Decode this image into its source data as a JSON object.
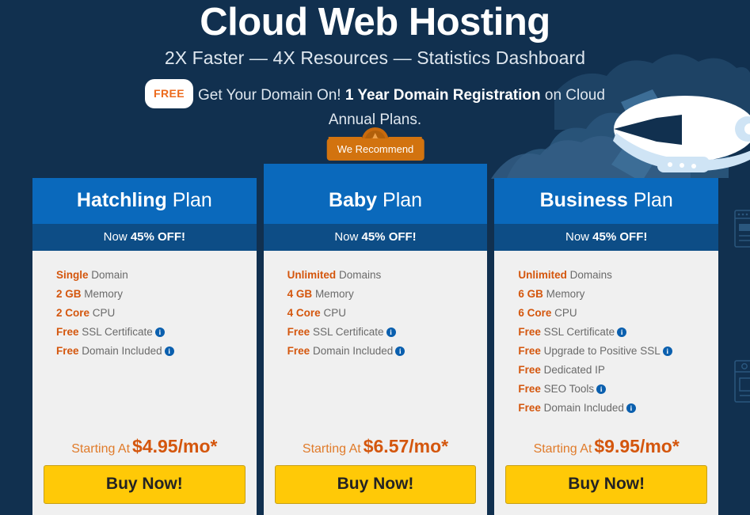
{
  "hero": {
    "title": "Cloud Web Hosting",
    "subtitle": "2X Faster — 4X Resources — Statistics Dashboard",
    "free_badge": "FREE",
    "promo_part1": "Get Your Domain On! ",
    "promo_bold": "1 Year Domain Registration",
    "promo_part2": " on Cloud Annual Plans."
  },
  "ribbon": {
    "label": "We Recommend"
  },
  "plans": [
    {
      "name_bold": "Hatchling",
      "name_rest": " Plan",
      "offer_prefix": "Now ",
      "offer_bold": "45% OFF!",
      "features": [
        {
          "bold": "Single",
          "rest": " Domain",
          "info": false
        },
        {
          "bold": "2 GB",
          "rest": " Memory",
          "info": false
        },
        {
          "bold": "2 Core",
          "rest": " CPU",
          "info": false
        },
        {
          "bold": "Free",
          "rest": " SSL Certificate",
          "info": true
        },
        {
          "bold": "Free",
          "rest": " Domain Included",
          "info": true
        }
      ],
      "price_prefix": "Starting At",
      "price": "$4.95/mo*",
      "cta": "Buy Now!",
      "featured": false
    },
    {
      "name_bold": "Baby",
      "name_rest": " Plan",
      "offer_prefix": "Now ",
      "offer_bold": "45% OFF!",
      "features": [
        {
          "bold": "Unlimited",
          "rest": " Domains",
          "info": false
        },
        {
          "bold": "4 GB",
          "rest": " Memory",
          "info": false
        },
        {
          "bold": "4 Core",
          "rest": " CPU",
          "info": false
        },
        {
          "bold": "Free",
          "rest": " SSL Certificate",
          "info": true
        },
        {
          "bold": "Free",
          "rest": " Domain Included",
          "info": true
        }
      ],
      "price_prefix": "Starting At",
      "price": "$6.57/mo*",
      "cta": "Buy Now!",
      "featured": true
    },
    {
      "name_bold": "Business",
      "name_rest": " Plan",
      "offer_prefix": "Now ",
      "offer_bold": "45% OFF!",
      "features": [
        {
          "bold": "Unlimited",
          "rest": " Domains",
          "info": false
        },
        {
          "bold": "6 GB",
          "rest": " Memory",
          "info": false
        },
        {
          "bold": "6 Core",
          "rest": " CPU",
          "info": false
        },
        {
          "bold": "Free",
          "rest": " SSL Certificate",
          "info": true
        },
        {
          "bold": "Free",
          "rest": " Upgrade to Positive SSL",
          "info": true
        },
        {
          "bold": "Free",
          "rest": " Dedicated IP",
          "info": false
        },
        {
          "bold": "Free",
          "rest": " SEO Tools",
          "info": true
        },
        {
          "bold": "Free",
          "rest": " Domain Included",
          "info": true
        }
      ],
      "price_prefix": "Starting At",
      "price": "$9.95/mo*",
      "cta": "Buy Now!",
      "featured": false
    }
  ],
  "colors": {
    "background": "#11304f",
    "card_header": "#0a69bc",
    "card_offer": "#0d4d86",
    "card_body": "#f0f0f0",
    "accent_orange": "#d4560d",
    "cta_yellow": "#ffc907",
    "info_blue": "#0a5fae",
    "ribbon_orange": "#d2730f"
  },
  "decor": {
    "airship": "blimp-illustration",
    "clouds": "cloud-shapes",
    "browser_windows": "browser-window-outlines"
  }
}
